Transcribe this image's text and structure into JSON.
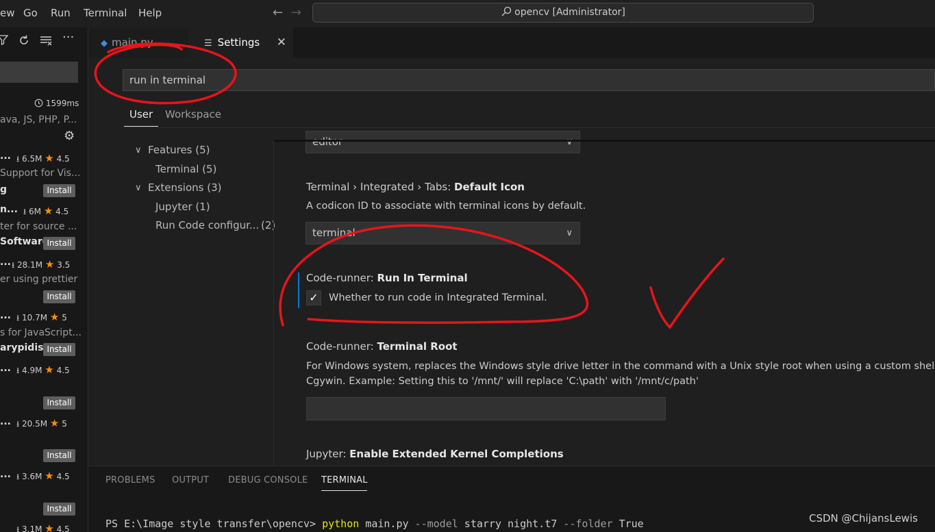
{
  "menu": [
    "ew",
    "Go",
    "Run",
    "Terminal",
    "Help"
  ],
  "command_center": "opencv [Administrator]",
  "sidebar": {
    "time": "1599ms",
    "desc_top": "ava, JS, PHP, P...",
    "extensions": [
      {
        "name": "...",
        "downloads": "6.5M",
        "rating": "4.5",
        "desc": "Support for Vis...",
        "publisher": "g",
        "install": "Install"
      },
      {
        "name": "n...",
        "downloads": "6M",
        "rating": "4.5",
        "desc": "ter for source ...",
        "publisher": "Software",
        "install": "Install"
      },
      {
        "name": "...",
        "downloads": "28.1M",
        "rating": "3.5",
        "desc": "er using prettier",
        "publisher": "",
        "install": "Install"
      },
      {
        "name": "...",
        "downloads": "10.7M",
        "rating": "5",
        "desc": "s for JavaScript...",
        "publisher": "arypidis",
        "install": "Install"
      },
      {
        "name": "...",
        "downloads": "4.9M",
        "rating": "4.5",
        "desc": "",
        "publisher": "",
        "install": "Install"
      },
      {
        "name": "...",
        "downloads": "20.5M",
        "rating": "5",
        "desc": "",
        "publisher": "",
        "install": "Install"
      },
      {
        "name": "...",
        "downloads": "3.6M",
        "rating": "4.5",
        "desc": "",
        "publisher": "",
        "install": "Install"
      },
      {
        "name": "...",
        "downloads": "3.1M",
        "rating": "4.5",
        "desc": "",
        "publisher": "",
        "install": "Install"
      }
    ]
  },
  "tabs": {
    "main": "main.py",
    "settings": "Settings"
  },
  "settings": {
    "search_value": "run in terminal",
    "scope_user": "User",
    "scope_workspace": "Workspace",
    "toc": {
      "features": "Features (5)",
      "terminal": "Terminal (5)",
      "extensions": "Extensions (3)",
      "jupyter": "Jupyter (1)",
      "run_code": "Run Code configur...",
      "run_code_count": "(2)"
    },
    "top_dropdown_value": "editor",
    "default_icon": {
      "prefix": "Terminal › Integrated › Tabs: ",
      "name": "Default Icon",
      "desc": "A codicon ID to associate with terminal icons by default.",
      "value": "terminal"
    },
    "run_in_terminal": {
      "prefix": "Code-runner: ",
      "name": "Run In Terminal",
      "desc": "Whether to run code in Integrated Terminal."
    },
    "terminal_root": {
      "prefix": "Code-runner: ",
      "name": "Terminal Root",
      "desc1": "For Windows system, replaces the Windows style drive letter in the command with a Unix style root when using a custom shell as",
      "desc2": "Cgywin. Example: Setting this to '/mnt/' will replace 'C:\\path' with '/mnt/c/path'"
    },
    "jupyter_completions": {
      "prefix": "Jupyter: ",
      "name": "Enable Extended Kernel Completions"
    }
  },
  "panel": {
    "tabs": [
      "PROBLEMS",
      "OUTPUT",
      "DEBUG CONSOLE",
      "TERMINAL"
    ],
    "terminal": {
      "prompt": "PS E:\\Image style transfer\\opencv> ",
      "cmd": "python",
      "arg1": " main.py ",
      "flag1": "--model",
      "arg2": " starry night.t7 ",
      "flag2": "--folder",
      "arg3": " True"
    }
  },
  "watermark": "CSDN @ChijansLewis",
  "colors": {
    "accent": "#0078d4",
    "annotation": "#e8141b",
    "star": "#ff8e00"
  }
}
